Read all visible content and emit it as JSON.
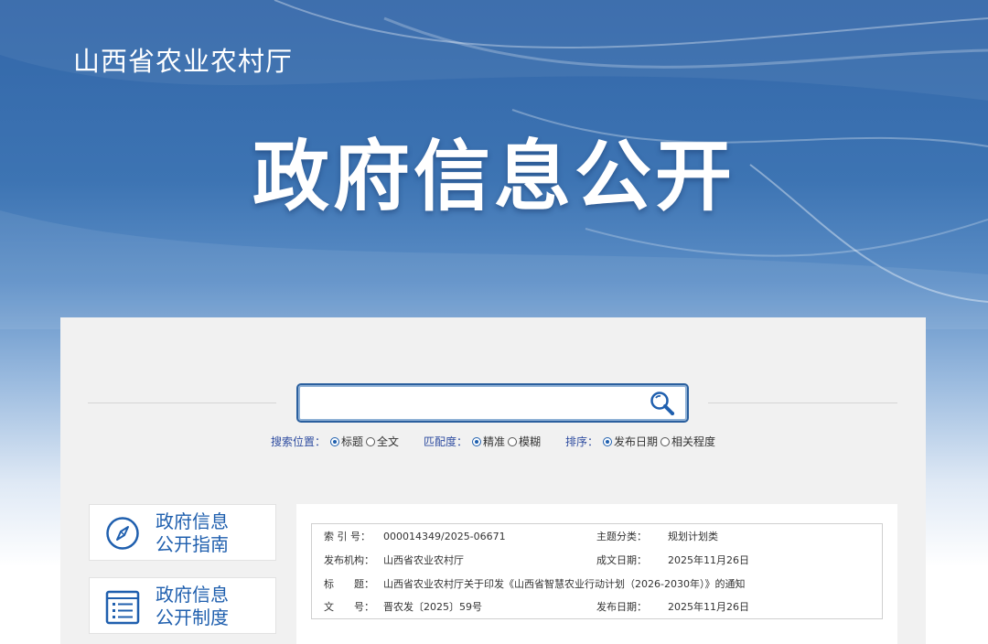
{
  "header": {
    "org_name": "山西省农业农村厅",
    "title": "政府信息公开"
  },
  "search": {
    "value": "",
    "placeholder": "",
    "button_icon": "search-icon",
    "options": {
      "position": {
        "label": "搜索位置：",
        "items": [
          "标题",
          "全文"
        ],
        "selected": "标题"
      },
      "match": {
        "label": "匹配度：",
        "items": [
          "精准",
          "模糊"
        ],
        "selected": "精准"
      },
      "sort": {
        "label": "排序：",
        "items": [
          "发布日期",
          "相关程度"
        ],
        "selected": "发布日期"
      }
    }
  },
  "sidebar": {
    "items": [
      {
        "line1": "政府信息",
        "line2": "公开指南",
        "icon": "compass-icon"
      },
      {
        "line1": "政府信息",
        "line2": "公开制度",
        "icon": "list-document-icon"
      }
    ]
  },
  "document_meta": {
    "index_label": "索 引 号：",
    "index_value": "000014349/2025-06671",
    "category_label": "主题分类：",
    "category_value": "规划计划类",
    "issuer_label": "发布机构：",
    "issuer_value": "山西省农业农村厅",
    "created_label": "成文日期：",
    "created_value": "2025年11月26日",
    "title_label": "标　　题：",
    "title_value": "山西省农业农村厅关于印发《山西省智慧农业行动计划（2026-2030年）》的通知",
    "docno_label": "文　　号：",
    "docno_value": "晋农发〔2025〕59号",
    "published_label": "发布日期：",
    "published_value": "2025年11月26日"
  },
  "colors": {
    "primary": "#1f5fae",
    "option_label": "#2f4da0",
    "banner_top": "#3266a8"
  }
}
